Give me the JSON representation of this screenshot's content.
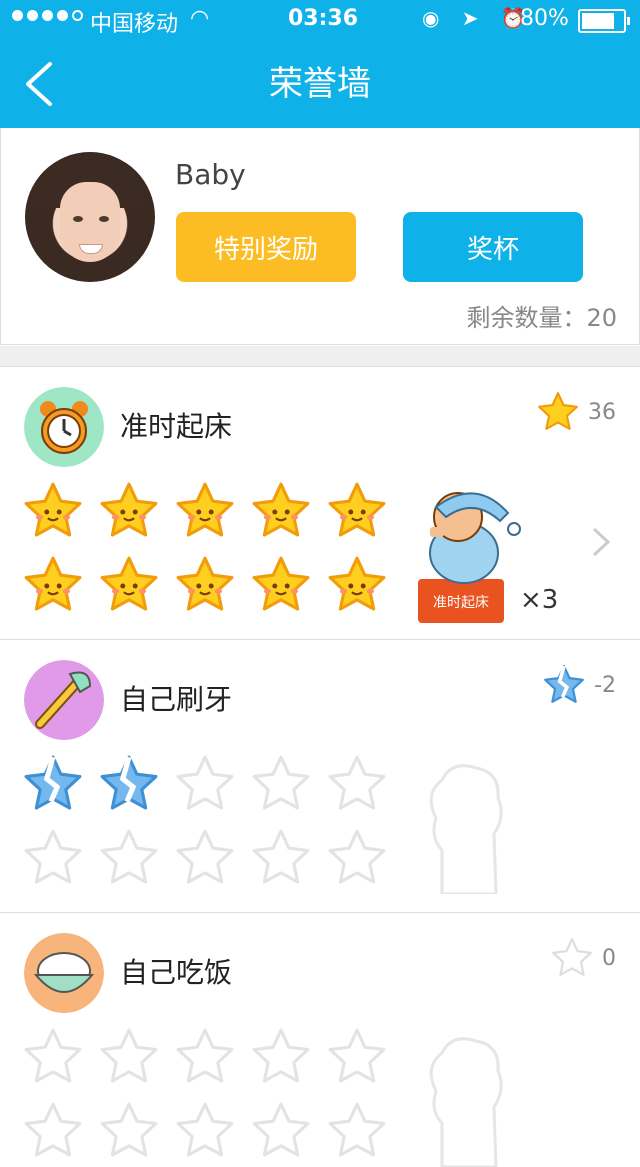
{
  "status": {
    "carrier": "中国移动",
    "time": "03:36",
    "battery": "80%"
  },
  "header": {
    "title": "荣誉墙"
  },
  "profile": {
    "name": "Baby",
    "special_label": "特别奖励",
    "trophy_label": "奖杯",
    "remaining": "剩余数量：20"
  },
  "tasks": [
    {
      "name": "准时起床",
      "count": "36",
      "stars_filled": 10,
      "stars_broken": 0,
      "reward_label": "准时起床",
      "multiplier": "×3",
      "icon_color": "#9fe6c7"
    },
    {
      "name": "自己刷牙",
      "count": "-2",
      "stars_filled": 0,
      "stars_broken": 2,
      "icon_color": "#e09ae8"
    },
    {
      "name": "自己吃饭",
      "count": "0",
      "stars_filled": 0,
      "stars_broken": 0,
      "icon_color": "#f7b57c"
    }
  ],
  "colors": {
    "accent": "#0fb2e8",
    "special": "#fcbd24",
    "star": "#ffcf1f",
    "broken_star": "#74b8ee"
  }
}
